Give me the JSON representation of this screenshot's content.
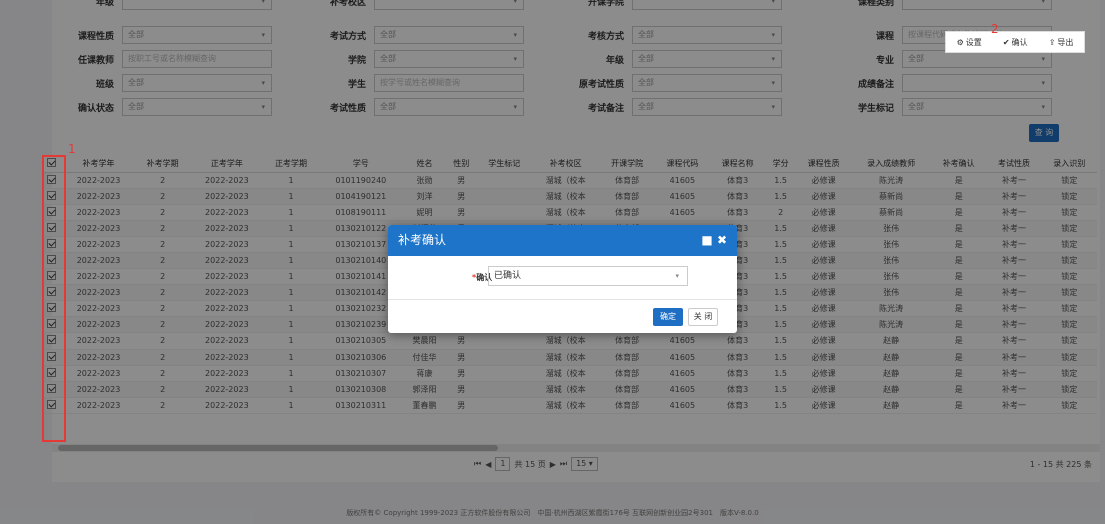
{
  "filters": {
    "row0": [
      {
        "label": "年级",
        "value": ""
      },
      {
        "label": "补考校区",
        "value": ""
      },
      {
        "label": "开课学院",
        "value": ""
      },
      {
        "label": "课程类别",
        "value": ""
      }
    ],
    "row1": [
      {
        "label": "课程性质",
        "value": "全部"
      },
      {
        "label": "考试方式",
        "value": "全部"
      },
      {
        "label": "考核方式",
        "value": "全部"
      },
      {
        "label": "课程",
        "placeholder": "按课程代码或名称模糊查询"
      }
    ],
    "row2": [
      {
        "label": "任课教师",
        "placeholder": "按职工号或名称模糊查询"
      },
      {
        "label": "学院",
        "value": "全部"
      },
      {
        "label": "年级",
        "value": "全部"
      },
      {
        "label": "专业",
        "value": "全部"
      }
    ],
    "row3": [
      {
        "label": "班级",
        "value": "全部"
      },
      {
        "label": "学生",
        "placeholder": "按学号或姓名模糊查询"
      },
      {
        "label": "原考试性质",
        "value": "全部"
      },
      {
        "label": "成绩备注",
        "value": ""
      }
    ],
    "row4": [
      {
        "label": "确认状态",
        "value": "全部"
      },
      {
        "label": "考试性质",
        "value": "全部"
      },
      {
        "label": "考试备注",
        "value": "全部"
      },
      {
        "label": "学生标记",
        "value": "全部"
      }
    ]
  },
  "query_label": "查 询",
  "toolbar": {
    "settings": "设置",
    "confirm": "确认",
    "export": "导出"
  },
  "marks": {
    "one": "1",
    "two": "2",
    "three": "3"
  },
  "table": {
    "headers": [
      "补考学年",
      "补考学期",
      "正考学年",
      "正考学期",
      "学号",
      "姓名",
      "性别",
      "学生标记",
      "补考校区",
      "开课学院",
      "课程代码",
      "课程名称",
      "学分",
      "课程性质",
      "录入成绩教师",
      "补考确认",
      "考试性质",
      "录入识别"
    ],
    "rows": [
      [
        "2022-2023",
        "2",
        "2022-2023",
        "1",
        "0101190240",
        "张勋",
        "男",
        "",
        "溜城（校本",
        "体育部",
        "41605",
        "体育3",
        "1.5",
        "必修课",
        "陈光涛",
        "是",
        "补考一",
        "锁定"
      ],
      [
        "2022-2023",
        "2",
        "2022-2023",
        "1",
        "0104190121",
        "刘洋",
        "男",
        "",
        "溜城（校本",
        "体育部",
        "41605",
        "体育3",
        "1.5",
        "必修课",
        "蔡新尚",
        "是",
        "补考一",
        "锁定"
      ],
      [
        "2022-2023",
        "2",
        "2022-2023",
        "1",
        "0108190111",
        "妮明",
        "男",
        "",
        "溜城（校本",
        "体育部",
        "41605",
        "体育3",
        "2",
        "必修课",
        "蔡新尚",
        "是",
        "补考一",
        "锁定"
      ],
      [
        "2022-2023",
        "2",
        "2022-2023",
        "1",
        "0130210122",
        "刘辉龙",
        "男",
        "",
        "溜城（校本",
        "体育部",
        "41605",
        "体育3",
        "1.5",
        "必修课",
        "张伟",
        "是",
        "补考一",
        "锁定"
      ],
      [
        "2022-2023",
        "2",
        "2022-2023",
        "1",
        "0130210137",
        "王玄苗",
        "男",
        "",
        "溜城（校本",
        "体育部",
        "41605",
        "体育3",
        "1.5",
        "必修课",
        "张伟",
        "是",
        "补考一",
        "锁定"
      ],
      [
        "2022-2023",
        "2",
        "2022-2023",
        "1",
        "0130210140",
        "薛俊豪",
        "男",
        "",
        "溜城（校本",
        "体育部",
        "41605",
        "体育3",
        "1.5",
        "必修课",
        "张伟",
        "是",
        "补考一",
        "锁定"
      ],
      [
        "2022-2023",
        "2",
        "2022-2023",
        "1",
        "0130210141",
        "杨治哲",
        "男",
        "",
        "溜城（校本",
        "体育部",
        "41605",
        "体育3",
        "1.5",
        "必修课",
        "张伟",
        "是",
        "补考一",
        "锁定"
      ],
      [
        "2022-2023",
        "2",
        "2022-2023",
        "1",
        "0130210142",
        "杨哲轩",
        "男",
        "",
        "溜城（校本",
        "体育部",
        "41605",
        "体育3",
        "1.5",
        "必修课",
        "张伟",
        "是",
        "补考一",
        "锁定"
      ],
      [
        "2022-2023",
        "2",
        "2022-2023",
        "1",
        "0130210232",
        "王凯",
        "男",
        "",
        "溜城（校本",
        "体育部",
        "41605",
        "体育3",
        "1.5",
        "必修课",
        "陈光涛",
        "是",
        "补考一",
        "锁定"
      ],
      [
        "2022-2023",
        "2",
        "2022-2023",
        "1",
        "0130210239",
        "张登辉",
        "男",
        "",
        "溜城（校本",
        "体育部",
        "41605",
        "体育3",
        "1.5",
        "必修课",
        "陈光涛",
        "是",
        "补考一",
        "锁定"
      ],
      [
        "2022-2023",
        "2",
        "2022-2023",
        "1",
        "0130210305",
        "樊晨阳",
        "男",
        "",
        "溜城（校本",
        "体育部",
        "41605",
        "体育3",
        "1.5",
        "必修课",
        "赵静",
        "是",
        "补考一",
        "锁定"
      ],
      [
        "2022-2023",
        "2",
        "2022-2023",
        "1",
        "0130210306",
        "付佳华",
        "男",
        "",
        "溜城（校本",
        "体育部",
        "41605",
        "体育3",
        "1.5",
        "必修课",
        "赵静",
        "是",
        "补考一",
        "锁定"
      ],
      [
        "2022-2023",
        "2",
        "2022-2023",
        "1",
        "0130210307",
        "蒋康",
        "男",
        "",
        "溜城（校本",
        "体育部",
        "41605",
        "体育3",
        "1.5",
        "必修课",
        "赵静",
        "是",
        "补考一",
        "锁定"
      ],
      [
        "2022-2023",
        "2",
        "2022-2023",
        "1",
        "0130210308",
        "郭泽阳",
        "男",
        "",
        "溜城（校本",
        "体育部",
        "41605",
        "体育3",
        "1.5",
        "必修课",
        "赵静",
        "是",
        "补考一",
        "锁定"
      ],
      [
        "2022-2023",
        "2",
        "2022-2023",
        "1",
        "0130210311",
        "董春鹏",
        "男",
        "",
        "溜城（校本",
        "体育部",
        "41605",
        "体育3",
        "1.5",
        "必修课",
        "赵静",
        "是",
        "补考一",
        "锁定"
      ]
    ]
  },
  "pager": {
    "page": "1",
    "total_pages": "共 15 页",
    "page_size": "15",
    "summary": "1 - 15  共 225 条"
  },
  "footer": "版权所有© Copyright 1999-2023 正方软件股份有限公司　中国·杭州西湖区紫霞街176号 互联网创新创业园2号301　版本V-8.0.0",
  "dialog": {
    "title": "补考确认",
    "field_required": "*",
    "field_label": "确认",
    "field_value": "已确认",
    "ok_label": "确定",
    "close_label": "关 闭"
  }
}
